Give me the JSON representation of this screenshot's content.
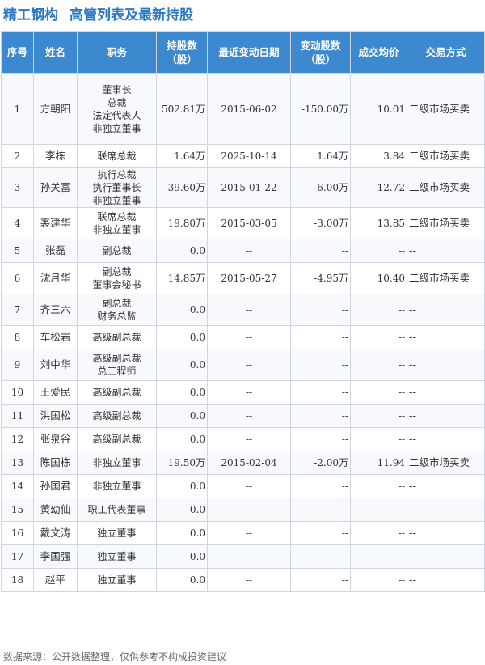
{
  "header": {
    "company": "精工钢构",
    "title": "高管列表及最新持股"
  },
  "columns": [
    "序号",
    "姓名",
    "职务",
    "持股数\n（股）",
    "最近变动日期",
    "变动股数\n（股）",
    "成交均价",
    "交易方式"
  ],
  "rows": [
    {
      "idx": "1",
      "name": "方朝阳",
      "positions": [
        "董事长",
        "总裁",
        "法定代表人",
        "非独立董事"
      ],
      "holdings": "502.81万",
      "date": "2015-06-02",
      "change": "-150.00万",
      "price": "10.01",
      "method": "二级市场买卖",
      "dir": "down"
    },
    {
      "idx": "2",
      "name": "李栋",
      "positions": [
        "联席总裁"
      ],
      "holdings": "1.64万",
      "date": "2025-10-14",
      "change": "1.64万",
      "price": "3.84",
      "method": "二级市场买卖",
      "dir": "up"
    },
    {
      "idx": "3",
      "name": "孙关富",
      "positions": [
        "执行总裁",
        "执行董事长",
        "非独立董事"
      ],
      "holdings": "39.60万",
      "date": "2015-01-22",
      "change": "-6.00万",
      "price": "12.72",
      "method": "二级市场买卖",
      "dir": "down"
    },
    {
      "idx": "4",
      "name": "裘建华",
      "positions": [
        "联席总裁",
        "非独立董事"
      ],
      "holdings": "19.80万",
      "date": "2015-03-05",
      "change": "-3.00万",
      "price": "13.85",
      "method": "二级市场买卖",
      "dir": "down"
    },
    {
      "idx": "5",
      "name": "张磊",
      "positions": [
        "副总裁"
      ],
      "holdings": "0.0",
      "date": "--",
      "change": "--",
      "price": "--",
      "method": "--",
      "dir": "none"
    },
    {
      "idx": "6",
      "name": "沈月华",
      "positions": [
        "副总裁",
        "董事会秘书"
      ],
      "holdings": "14.85万",
      "date": "2015-05-27",
      "change": "-4.95万",
      "price": "10.40",
      "method": "二级市场买卖",
      "dir": "down"
    },
    {
      "idx": "7",
      "name": "齐三六",
      "positions": [
        "副总裁",
        "财务总监"
      ],
      "holdings": "0.0",
      "date": "--",
      "change": "--",
      "price": "--",
      "method": "--",
      "dir": "none"
    },
    {
      "idx": "8",
      "name": "车松岩",
      "positions": [
        "高级副总裁"
      ],
      "holdings": "0.0",
      "date": "--",
      "change": "--",
      "price": "--",
      "method": "--",
      "dir": "none"
    },
    {
      "idx": "9",
      "name": "刘中华",
      "positions": [
        "高级副总裁",
        "总工程师"
      ],
      "holdings": "0.0",
      "date": "--",
      "change": "--",
      "price": "--",
      "method": "--",
      "dir": "none"
    },
    {
      "idx": "10",
      "name": "王爱民",
      "positions": [
        "高级副总裁"
      ],
      "holdings": "0.0",
      "date": "--",
      "change": "--",
      "price": "--",
      "method": "--",
      "dir": "none"
    },
    {
      "idx": "11",
      "name": "洪国松",
      "positions": [
        "高级副总裁"
      ],
      "holdings": "0.0",
      "date": "--",
      "change": "--",
      "price": "--",
      "method": "--",
      "dir": "none"
    },
    {
      "idx": "12",
      "name": "张泉谷",
      "positions": [
        "高级副总裁"
      ],
      "holdings": "0.0",
      "date": "--",
      "change": "--",
      "price": "--",
      "method": "--",
      "dir": "none"
    },
    {
      "idx": "13",
      "name": "陈国栋",
      "positions": [
        "非独立董事"
      ],
      "holdings": "19.50万",
      "date": "2015-02-04",
      "change": "-2.00万",
      "price": "11.94",
      "method": "二级市场买卖",
      "dir": "down"
    },
    {
      "idx": "14",
      "name": "孙国君",
      "positions": [
        "非独立董事"
      ],
      "holdings": "0.0",
      "date": "--",
      "change": "--",
      "price": "--",
      "method": "--",
      "dir": "none"
    },
    {
      "idx": "15",
      "name": "黄幼仙",
      "positions": [
        "职工代表董事"
      ],
      "holdings": "0.0",
      "date": "--",
      "change": "--",
      "price": "--",
      "method": "--",
      "dir": "none"
    },
    {
      "idx": "16",
      "name": "戴文涛",
      "positions": [
        "独立董事"
      ],
      "holdings": "0.0",
      "date": "--",
      "change": "--",
      "price": "--",
      "method": "--",
      "dir": "none"
    },
    {
      "idx": "17",
      "name": "李国强",
      "positions": [
        "独立董事"
      ],
      "holdings": "0.0",
      "date": "--",
      "change": "--",
      "price": "--",
      "method": "--",
      "dir": "none"
    },
    {
      "idx": "18",
      "name": "赵平",
      "positions": [
        "独立董事"
      ],
      "holdings": "0.0",
      "date": "--",
      "change": "--",
      "price": "--",
      "method": "--",
      "dir": "none"
    }
  ],
  "footer": "数据来源：公开数据整理，仅供参考不构成投资建议",
  "colors": {
    "header_bg": "#3d89cf",
    "title": "#2a78c4",
    "up": "#e02020",
    "down": "#1a9a3a"
  }
}
